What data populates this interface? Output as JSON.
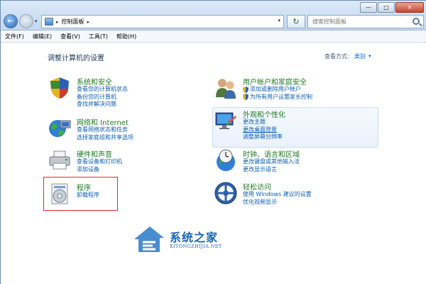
{
  "window": {
    "buttons": {
      "minimize": "—",
      "maximize": "□",
      "close": "✕"
    }
  },
  "address_bar": {
    "crumb": "控制面板",
    "separator": "▸",
    "dropdown": "▾"
  },
  "nav": {
    "back": "←",
    "forward": "→",
    "dropdown": "▾",
    "refresh": "↻"
  },
  "search": {
    "placeholder": "搜索控制面板"
  },
  "menu": [
    "文件(F)",
    "编辑(E)",
    "查看(V)",
    "工具(T)",
    "帮助(H)"
  ],
  "main": {
    "title": "调整计算机的设置",
    "view_by_label": "查看方式:",
    "view_by_value": "类别",
    "view_by_arrow": "▾"
  },
  "categories": [
    {
      "title": "系统和安全",
      "links": [
        "查看您的计算机状态",
        "备份您的计算机",
        "查找并解决问题"
      ]
    },
    {
      "title": "网络和 Internet",
      "links": [
        "查看网络状态和任务",
        "选择家庭组和共享选项"
      ]
    },
    {
      "title": "硬件和声音",
      "links": [
        "查看设备和打印机",
        "添加设备"
      ]
    },
    {
      "title": "程序",
      "links": [
        "卸载程序"
      ]
    },
    {
      "title": "用户帐户和家庭安全",
      "links": [
        "添加或删除用户帐户",
        "为所有用户设置家长控制"
      ]
    },
    {
      "title": "外观和个性化",
      "links": [
        "更改主题",
        "更改桌面背景",
        "调整屏幕分辨率"
      ]
    },
    {
      "title": "时钟、语言和区域",
      "links": [
        "更改键盘或其他输入法",
        "更改显示语言"
      ]
    },
    {
      "title": "轻松访问",
      "links": [
        "使用 Windows 建议的设置",
        "优化视频显示"
      ]
    }
  ],
  "watermark": {
    "text": "系统之家",
    "sub": "XITONGZHIJIA.NET"
  },
  "colors": {
    "link": "#0b5eb3",
    "category_title": "#217a24",
    "highlight_border": "#e6282b"
  }
}
